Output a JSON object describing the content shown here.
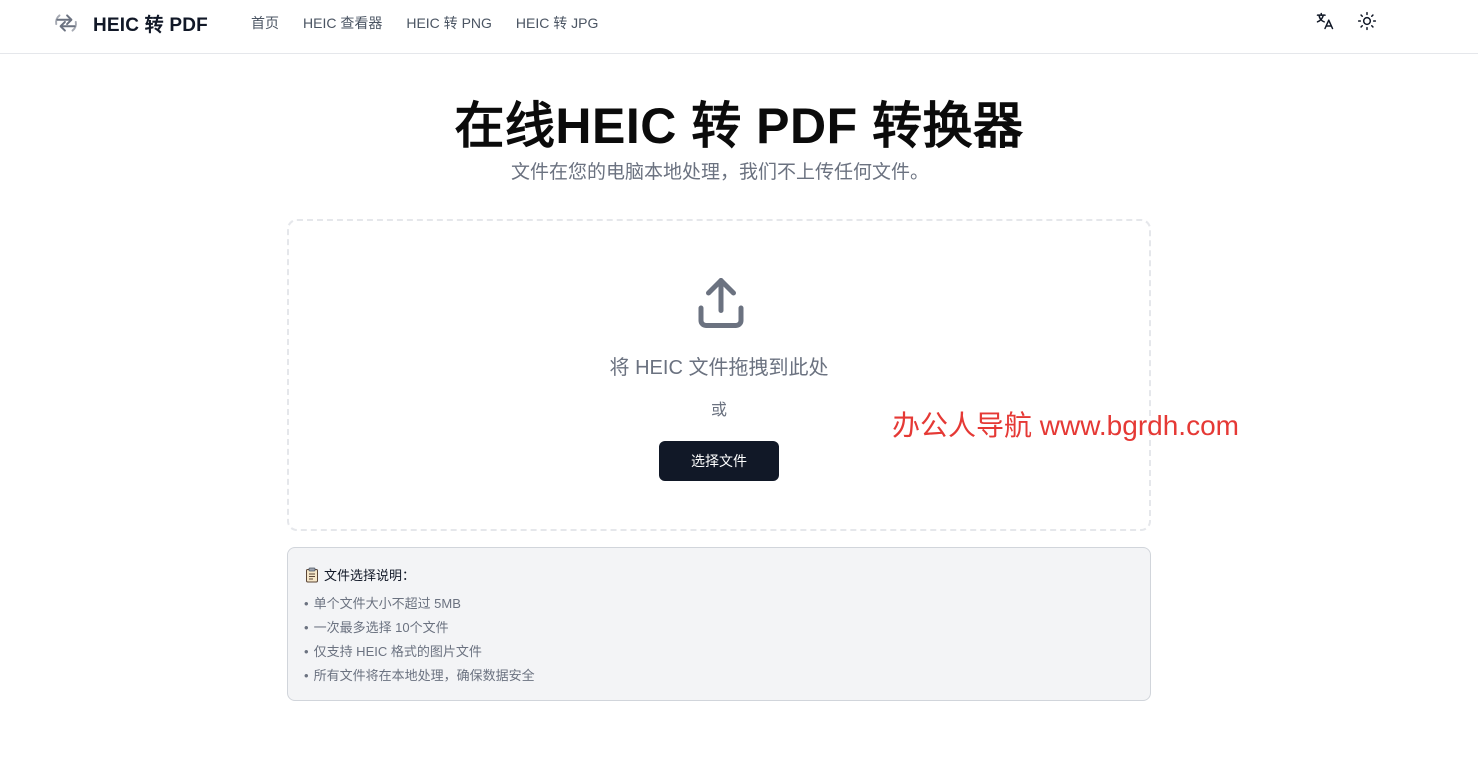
{
  "header": {
    "brand_icon": "convert-arrows-icon",
    "brand_title": "HEIC 转 PDF",
    "nav": [
      {
        "label": "首页"
      },
      {
        "label": "HEIC 查看器"
      },
      {
        "label": "HEIC 转 PNG"
      },
      {
        "label": "HEIC 转 JPG"
      }
    ],
    "actions": {
      "language_icon": "translate-icon",
      "theme_icon": "sun-icon"
    }
  },
  "hero": {
    "title": "在线HEIC 转 PDF 转换器",
    "subtitle": "文件在您的电脑本地处理，我们不上传任何文件。"
  },
  "dropzone": {
    "icon": "upload-icon",
    "drag_text": "将 HEIC 文件拖拽到此处",
    "or_text": "或",
    "select_button": "选择文件"
  },
  "watermark": {
    "text": "办公人导航 www.bgrdh.com",
    "color": "#e53935"
  },
  "info": {
    "icon": "clipboard-icon",
    "title": "文件选择说明：",
    "bullet": "•",
    "items": [
      "单个文件大小不超过 5MB",
      "一次最多选择 10个文件",
      "仅支持 HEIC 格式的图片文件",
      "所有文件将在本地处理，确保数据安全"
    ]
  },
  "colors": {
    "primary_button": "#111827",
    "muted_text": "#6b7280",
    "info_bg": "#f3f4f6"
  }
}
